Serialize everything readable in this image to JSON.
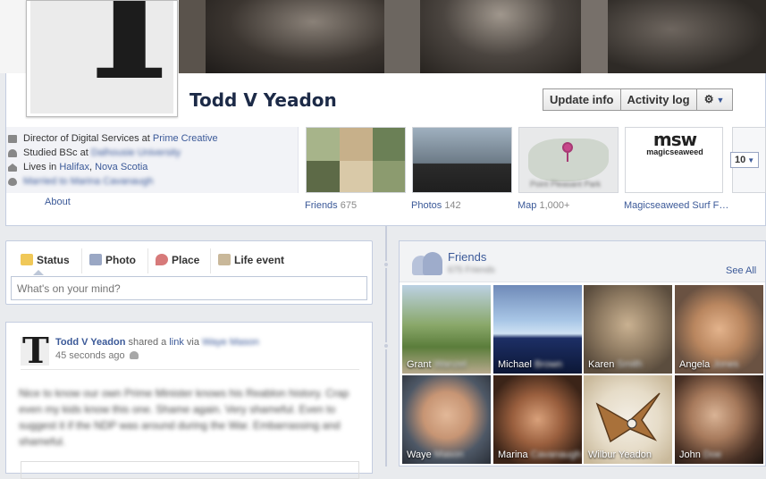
{
  "profile": {
    "name": "Todd V Yeadon",
    "monogram": "T"
  },
  "header_buttons": {
    "update_info": "Update info",
    "activity_log": "Activity log",
    "settings_icon": "gear-icon"
  },
  "about": {
    "work_prefix": "Director of Digital Services at ",
    "work_employer": "Prime Creative",
    "education_prefix": "Studied BSc at ",
    "education_school": "Dalhousie University",
    "lives_prefix": "Lives in ",
    "lives_city": "Halifax",
    "lives_sep": ", ",
    "lives_region": "Nova Scotia",
    "relationship": "Married to Marina Cavanaugh",
    "about_link": "About"
  },
  "apps": {
    "friends_label": "Friends",
    "friends_count": "675",
    "photos_label": "Photos",
    "photos_count": "142",
    "map_label": "Map",
    "map_count": "1,000+",
    "map_caption": "Point Pleasant Park",
    "magic_label": "Magicseaweed Surf F…",
    "magic_logo": "msw",
    "magic_sub": "magicseaweed",
    "more_count": "10"
  },
  "composer": {
    "tabs": [
      "Status",
      "Photo",
      "Place",
      "Life event"
    ],
    "placeholder": "What's on your mind?"
  },
  "post": {
    "author": "Todd V Yeadon",
    "shared_text": " shared a ",
    "link_word": "link",
    "via_text": " via ",
    "via_name": "Waye Mason",
    "time": "45 seconds ago",
    "body": "Nice to know our own Prime Minister knows his Reablon history. Crap even my kids know this one. Shame again. Very shameful. Even to suggest it if the NDP was around during the War. Embarrassing and shameful."
  },
  "friends_box": {
    "title": "Friends",
    "count": "675 Friends",
    "see_all": "See All",
    "friends": [
      {
        "first": "Grant",
        "last": "Wanzel"
      },
      {
        "first": "Michael",
        "last": "Brown"
      },
      {
        "first": "Karen",
        "last": "Smith"
      },
      {
        "first": "Angela",
        "last": "Jones"
      },
      {
        "first": "Waye",
        "last": "Mason"
      },
      {
        "first": "Marina",
        "last": "Cavanaugh"
      },
      {
        "first": "Wilbur Yeadon",
        "last": ""
      },
      {
        "first": "John",
        "last": "Doe"
      }
    ]
  },
  "colors": {
    "link": "#3b5998",
    "border": "#c4cde0",
    "background": "#e9ebee"
  }
}
